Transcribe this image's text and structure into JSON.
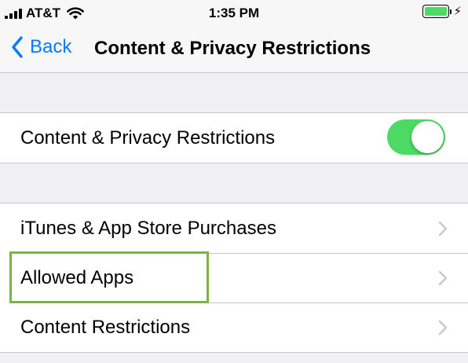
{
  "status_bar": {
    "carrier": "AT&T",
    "time": "1:35 PM",
    "battery_level": 1.0,
    "charging": true,
    "battery_color": "#4cd964"
  },
  "nav": {
    "back_label": "Back",
    "title": "Content & Privacy Restrictions",
    "accent_color": "#007aff"
  },
  "toggle_section": {
    "label": "Content & Privacy Restrictions",
    "enabled": true,
    "toggle_color": "#4cd964"
  },
  "menu": {
    "items": [
      {
        "label": "iTunes & App Store Purchases",
        "icon": "chevron-right-icon"
      },
      {
        "label": "Allowed Apps",
        "icon": "chevron-right-icon",
        "highlighted": true
      },
      {
        "label": "Content Restrictions",
        "icon": "chevron-right-icon"
      }
    ],
    "highlight_color": "#7cb342"
  }
}
